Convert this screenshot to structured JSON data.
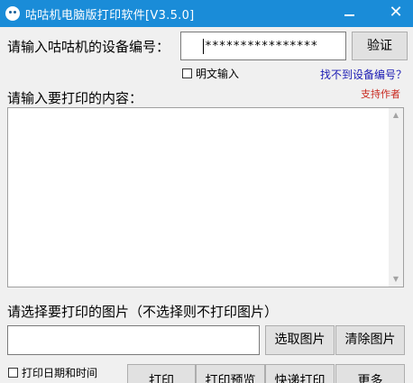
{
  "window": {
    "title": "咕咕机电脑版打印软件[V3.5.0]",
    "minimize_symbol": "—",
    "close_symbol": "✕"
  },
  "device": {
    "label": "请输入咕咕机的设备编号：",
    "value": "****************",
    "verify_label": "验证",
    "show_plaintext_label": "明文输入",
    "not_found_link": "找不到设备编号？"
  },
  "content": {
    "label": "请输入要打印的内容：",
    "support_link": "支持作者",
    "value": ""
  },
  "image": {
    "label": "请选择要打印的图片（不选择则不打印图片）",
    "path_value": "",
    "select_label": "选取图片",
    "clear_label": "清除图片"
  },
  "footer": {
    "print_date_label": "打印日期和时间",
    "print_label": "打印",
    "preview_label": "打印预览",
    "express_label": "快递打印",
    "more_label": "更多"
  },
  "colors": {
    "titlebar": "#1a8cd8",
    "link_blue": "#1c1cb4",
    "link_red": "#c8281e"
  },
  "icons": {
    "app": "app-logo-icon",
    "scroll_up": "scroll-up-arrow-icon",
    "scroll_down": "scroll-down-arrow-icon"
  }
}
